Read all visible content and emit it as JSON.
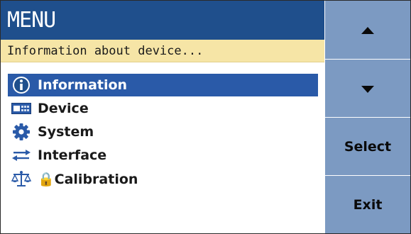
{
  "header": {
    "title": "MENU"
  },
  "info_bar": {
    "text": "Information about device..."
  },
  "menu": {
    "items": [
      {
        "label": "Information",
        "icon": "info-icon",
        "selected": true
      },
      {
        "label": "Device",
        "icon": "device-icon",
        "selected": false
      },
      {
        "label": "System",
        "icon": "gear-icon",
        "selected": false
      },
      {
        "label": "Interface",
        "icon": "interface-arrows-icon",
        "selected": false
      },
      {
        "label": "🔒Calibration",
        "icon": "scales-icon",
        "selected": false
      }
    ]
  },
  "soft_keys": {
    "up": {
      "label": "",
      "icon": "triangle-up-icon"
    },
    "down": {
      "label": "",
      "icon": "triangle-down-icon"
    },
    "select": {
      "label": "Select"
    },
    "exit": {
      "label": "Exit"
    }
  },
  "colors": {
    "title_bg": "#1f4f8c",
    "info_bg": "#f6e5a6",
    "selection_bg": "#2a5aa8",
    "softkey_bg": "#7c9ac2"
  }
}
